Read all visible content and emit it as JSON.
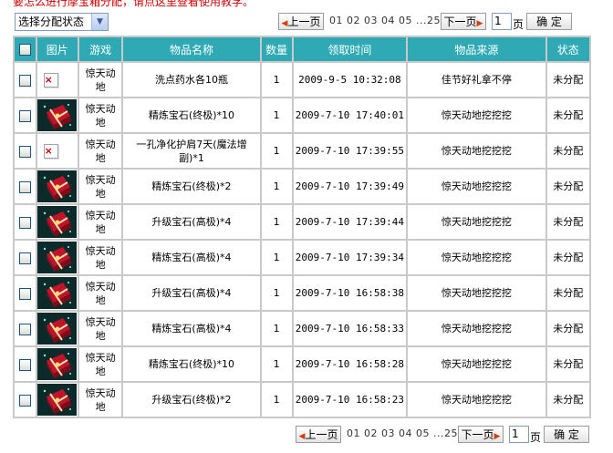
{
  "notice": {
    "text": "要怎么进行摩宝箱分配，请点这里",
    "link": "查看使用教学。"
  },
  "status_select": {
    "value": "选择分配状态"
  },
  "pager": {
    "prev": "上一页",
    "next": "下一页",
    "pages": "01 02 03 04 05 ...25",
    "page_value": "1",
    "page_unit": "页",
    "confirm": "确 定"
  },
  "table": {
    "headers": [
      "图片",
      "游戏",
      "物品名称",
      "数量",
      "领取时间",
      "物品来源",
      "状态"
    ],
    "rows": [
      {
        "img": "broken",
        "game": "惊天动地",
        "name": "洗点药水各10瓶",
        "qty": "1",
        "time": "2009-9-5 10:32:08",
        "source": "佳节好礼拿不停",
        "status": "未分配"
      },
      {
        "img": "gift",
        "game": "惊天动地",
        "name": "精炼宝石(终极)*10",
        "qty": "1",
        "time": "2009-7-10 17:40:01",
        "source": "惊天动地挖挖挖",
        "status": "未分配"
      },
      {
        "img": "broken",
        "game": "惊天动地",
        "name": "一孔净化护肩7天(魔法增副)*1",
        "qty": "1",
        "time": "2009-7-10 17:39:55",
        "source": "惊天动地挖挖挖",
        "status": "未分配"
      },
      {
        "img": "gift",
        "game": "惊天动地",
        "name": "精炼宝石(终极)*2",
        "qty": "1",
        "time": "2009-7-10 17:39:49",
        "source": "惊天动地挖挖挖",
        "status": "未分配"
      },
      {
        "img": "gift",
        "game": "惊天动地",
        "name": "升级宝石(高极)*4",
        "qty": "1",
        "time": "2009-7-10 17:39:44",
        "source": "惊天动地挖挖挖",
        "status": "未分配"
      },
      {
        "img": "gift",
        "game": "惊天动地",
        "name": "精炼宝石(高极)*4",
        "qty": "1",
        "time": "2009-7-10 17:39:34",
        "source": "惊天动地挖挖挖",
        "status": "未分配"
      },
      {
        "img": "gift",
        "game": "惊天动地",
        "name": "升级宝石(高极)*4",
        "qty": "1",
        "time": "2009-7-10 16:58:38",
        "source": "惊天动地挖挖挖",
        "status": "未分配"
      },
      {
        "img": "gift",
        "game": "惊天动地",
        "name": "精炼宝石(高极)*4",
        "qty": "1",
        "time": "2009-7-10 16:58:33",
        "source": "惊天动地挖挖挖",
        "status": "未分配"
      },
      {
        "img": "gift",
        "game": "惊天动地",
        "name": "精炼宝石(终极)*10",
        "qty": "1",
        "time": "2009-7-10 16:58:28",
        "source": "惊天动地挖挖挖",
        "status": "未分配"
      },
      {
        "img": "gift",
        "game": "惊天动地",
        "name": "升级宝石(终极)*2",
        "qty": "1",
        "time": "2009-7-10 16:58:23",
        "source": "惊天动地挖挖挖",
        "status": "未分配"
      }
    ]
  },
  "colors": {
    "header_bg": "#2fa9b4",
    "notice_red": "#cc0000",
    "grid_border": "#c9c9c9"
  },
  "icons": {
    "broken_image": "broken-image-icon",
    "gift_item": "gift-box-icon",
    "checkbox": "checkbox-icon"
  }
}
